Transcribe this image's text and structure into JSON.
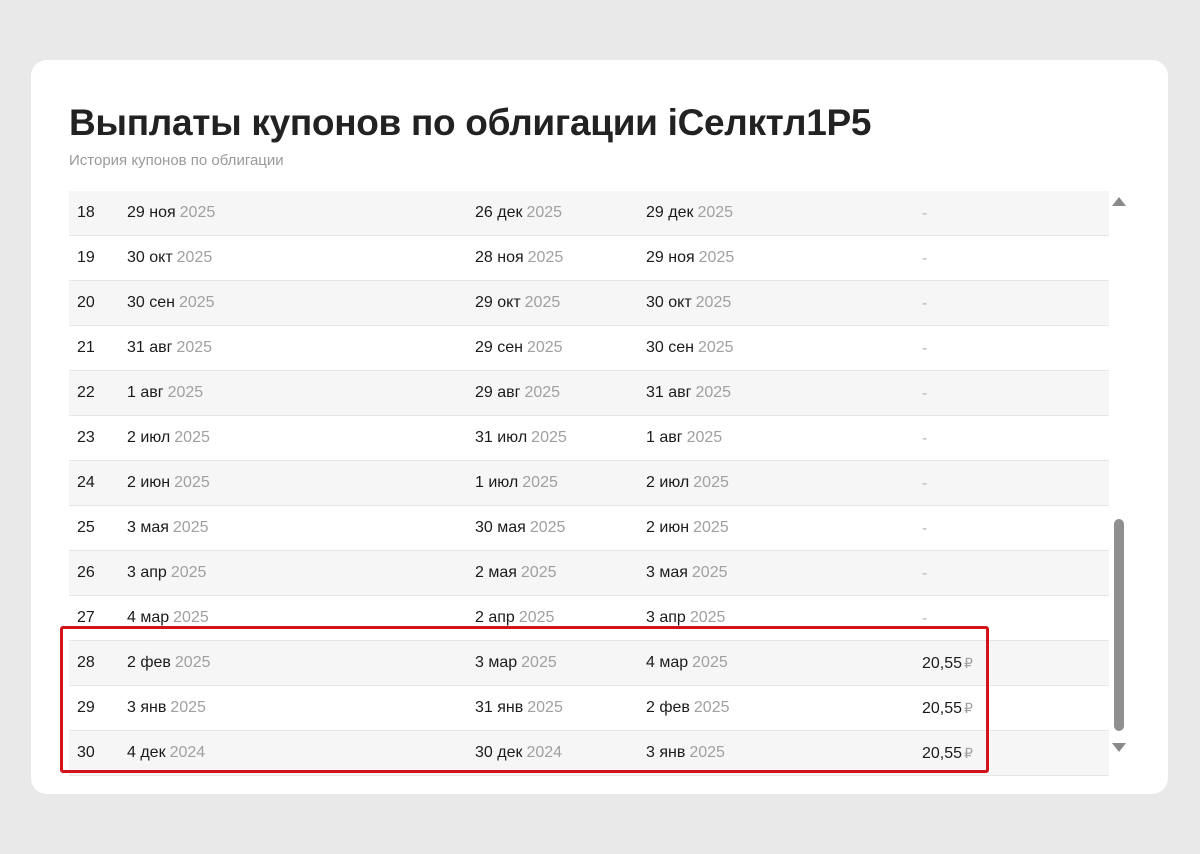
{
  "header": {
    "title": "Выплаты купонов по облигации iСелктл1Р5",
    "subtitle": "История купонов по облигации"
  },
  "rows": [
    {
      "num": "18",
      "d1": "29 ноя",
      "y1": "2025",
      "d2": "26 дек",
      "y2": "2025",
      "d3": "29 дек",
      "y3": "2025",
      "amount": "-",
      "currency": ""
    },
    {
      "num": "19",
      "d1": "30 окт",
      "y1": "2025",
      "d2": "28 ноя",
      "y2": "2025",
      "d3": "29 ноя",
      "y3": "2025",
      "amount": "-",
      "currency": ""
    },
    {
      "num": "20",
      "d1": "30 сен",
      "y1": "2025",
      "d2": "29 окт",
      "y2": "2025",
      "d3": "30 окт",
      "y3": "2025",
      "amount": "-",
      "currency": ""
    },
    {
      "num": "21",
      "d1": "31 авг",
      "y1": "2025",
      "d2": "29 сен",
      "y2": "2025",
      "d3": "30 сен",
      "y3": "2025",
      "amount": "-",
      "currency": ""
    },
    {
      "num": "22",
      "d1": "1 авг",
      "y1": "2025",
      "d2": "29 авг",
      "y2": "2025",
      "d3": "31 авг",
      "y3": "2025",
      "amount": "-",
      "currency": ""
    },
    {
      "num": "23",
      "d1": "2 июл",
      "y1": "2025",
      "d2": "31 июл",
      "y2": "2025",
      "d3": "1 авг",
      "y3": "2025",
      "amount": "-",
      "currency": ""
    },
    {
      "num": "24",
      "d1": "2 июн",
      "y1": "2025",
      "d2": "1 июл",
      "y2": "2025",
      "d3": "2 июл",
      "y3": "2025",
      "amount": "-",
      "currency": ""
    },
    {
      "num": "25",
      "d1": "3 мая",
      "y1": "2025",
      "d2": "30 мая",
      "y2": "2025",
      "d3": "2 июн",
      "y3": "2025",
      "amount": "-",
      "currency": ""
    },
    {
      "num": "26",
      "d1": "3 апр",
      "y1": "2025",
      "d2": "2 мая",
      "y2": "2025",
      "d3": "3 мая",
      "y3": "2025",
      "amount": "-",
      "currency": ""
    },
    {
      "num": "27",
      "d1": "4 мар",
      "y1": "2025",
      "d2": "2 апр",
      "y2": "2025",
      "d3": "3 апр",
      "y3": "2025",
      "amount": "-",
      "currency": ""
    },
    {
      "num": "28",
      "d1": "2 фев",
      "y1": "2025",
      "d2": "3 мар",
      "y2": "2025",
      "d3": "4 мар",
      "y3": "2025",
      "amount": "20,55",
      "currency": "₽"
    },
    {
      "num": "29",
      "d1": "3 янв",
      "y1": "2025",
      "d2": "31 янв",
      "y2": "2025",
      "d3": "2 фев",
      "y3": "2025",
      "amount": "20,55",
      "currency": "₽"
    },
    {
      "num": "30",
      "d1": "4 дек",
      "y1": "2024",
      "d2": "30 дек",
      "y2": "2024",
      "d3": "3 янв",
      "y3": "2025",
      "amount": "20,55",
      "currency": "₽"
    }
  ],
  "colors": {
    "highlight": "#d2131c",
    "background": "#e9e9e9"
  },
  "scrollbar": {
    "up_icon": "triangle-up-icon",
    "down_icon": "triangle-down-icon"
  }
}
